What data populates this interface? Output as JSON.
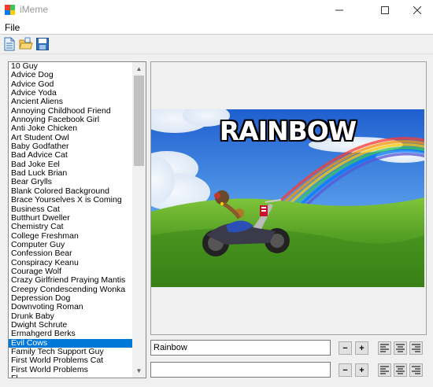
{
  "window": {
    "title": "iMeme"
  },
  "menu": {
    "file": "File"
  },
  "meme_list": {
    "items": [
      "10 Guy",
      "Advice Dog",
      "Advice God",
      "Advice Yoda",
      "Ancient Aliens",
      "Annoying Childhood Friend",
      "Annoying Facebook Girl",
      "Anti Joke Chicken",
      "Art Student Owl",
      "Baby Godfather",
      "Bad Advice Cat",
      "Bad Joke Eel",
      "Bad Luck Brian",
      "Bear Grylls",
      "Blank Colored Background",
      "Brace Yourselves X is Coming",
      "Business Cat",
      "Butthurt Dweller",
      "Chemistry Cat",
      "College Freshman",
      "Computer Guy",
      "Confession Bear",
      "Conspiracy Keanu",
      "Courage Wolf",
      "Crazy Girlfriend Praying Mantis",
      "Creepy Condescending Wonka",
      "Depression Dog",
      "Downvoting Roman",
      "Drunk Baby",
      "Dwight Schrute",
      "Ermahgerd Berks",
      "Evil Cows",
      "Family Tech Support Guy",
      "First World Problems Cat",
      "First World Problems",
      "Fl..."
    ],
    "selected_index": 31
  },
  "preview": {
    "caption": "RAINBOW"
  },
  "top_text": {
    "value": "Rainbow"
  },
  "bottom_text": {
    "value": ""
  },
  "controls": {
    "minus": "−",
    "plus": "+"
  }
}
